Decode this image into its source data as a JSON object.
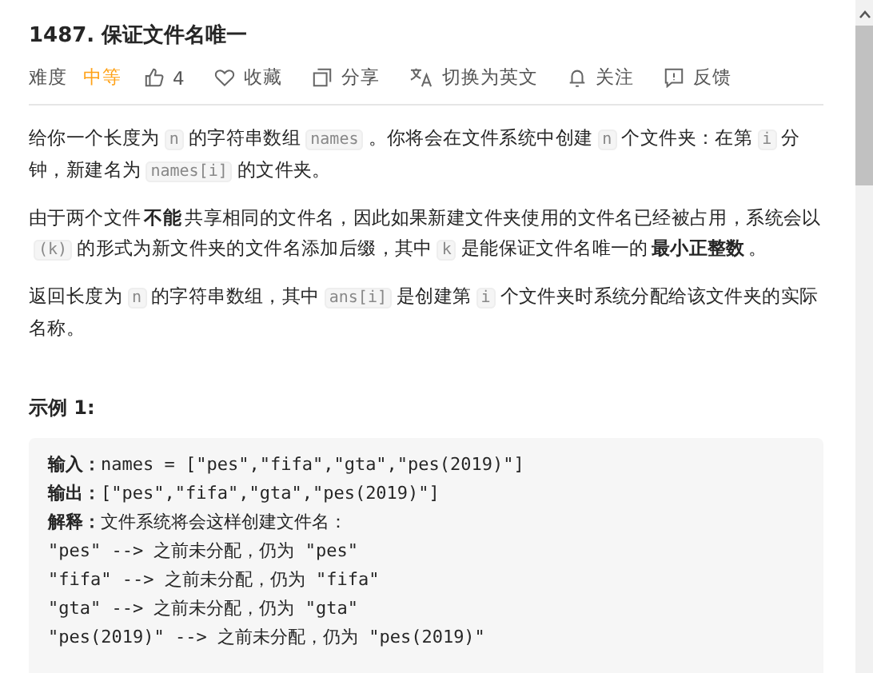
{
  "title": "1487. 保证文件名唯一",
  "toolbar": {
    "difficulty_label": "难度",
    "difficulty": "中等",
    "items": [
      {
        "kind": "like",
        "label": "4"
      },
      {
        "kind": "star",
        "label": "收藏"
      },
      {
        "kind": "share",
        "label": "分享"
      },
      {
        "kind": "translate",
        "label": "切换为英文"
      },
      {
        "kind": "bell",
        "label": "关注"
      },
      {
        "kind": "feedback",
        "label": "反馈"
      }
    ]
  },
  "paragraphs": [
    [
      {
        "kind": "text",
        "text": "给你一个长度为"
      },
      {
        "kind": "code",
        "text": "n"
      },
      {
        "kind": "text",
        "text": "的字符串数组"
      },
      {
        "kind": "code",
        "text": "names"
      },
      {
        "kind": "text",
        "text": "。你将会在文件系统中创建"
      },
      {
        "kind": "code",
        "text": "n"
      },
      {
        "kind": "text",
        "text": "个文件夹：在第"
      },
      {
        "kind": "code",
        "text": "i"
      },
      {
        "kind": "text",
        "text": "分钟，新建名为"
      },
      {
        "kind": "code",
        "text": "names[i]"
      },
      {
        "kind": "text",
        "text": "的文件夹。"
      }
    ],
    [
      {
        "kind": "text",
        "text": "由于两个文件"
      },
      {
        "kind": "bold",
        "text": "不能"
      },
      {
        "kind": "text",
        "text": "共享相同的文件名，因此如果新建文件夹使用的文件名已经被占用，系统会以"
      },
      {
        "kind": "code",
        "text": "(k)"
      },
      {
        "kind": "text",
        "text": "的形式为新文件夹的文件名添加后缀，其中"
      },
      {
        "kind": "code",
        "text": "k"
      },
      {
        "kind": "text",
        "text": "是能保证文件名唯一的"
      },
      {
        "kind": "bold",
        "text": "最小正整数"
      },
      {
        "kind": "text",
        "text": "。"
      }
    ],
    [
      {
        "kind": "text",
        "text": "返回长度为"
      },
      {
        "kind": "code",
        "text": "n"
      },
      {
        "kind": "text",
        "text": "的字符串数组，其中"
      },
      {
        "kind": "code",
        "text": "ans[i]"
      },
      {
        "kind": "text",
        "text": "是创建第"
      },
      {
        "kind": "code",
        "text": "i"
      },
      {
        "kind": "text",
        "text": "个文件夹时系统分配给该文件夹的实际名称。"
      }
    ]
  ],
  "example": {
    "heading": "示例 1:",
    "lines": [
      {
        "label": "输入：",
        "text": "names = [\"pes\",\"fifa\",\"gta\",\"pes(2019)\"]"
      },
      {
        "label": "输出：",
        "text": "[\"pes\",\"fifa\",\"gta\",\"pes(2019)\"]"
      },
      {
        "label": "解释：",
        "text": "文件系统将会这样创建文件名："
      },
      {
        "text": "\"pes\" --> 之前未分配，仍为 \"pes\""
      },
      {
        "text": "\"fifa\" --> 之前未分配，仍为 \"fifa\""
      },
      {
        "text": "\"gta\" --> 之前未分配，仍为 \"gta\""
      },
      {
        "text": "\"pes(2019)\" --> 之前未分配，仍为 \"pes(2019)\""
      }
    ]
  }
}
